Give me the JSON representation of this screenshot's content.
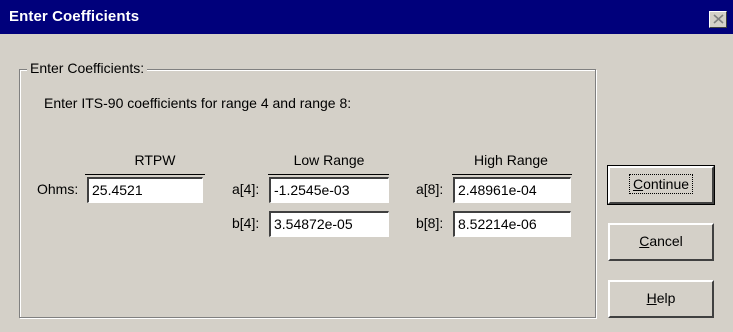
{
  "window": {
    "title": "Enter Coefficients"
  },
  "group": {
    "label": "Enter Coefficients:",
    "instructions": "Enter ITS-90 coefficients for range 4 and range 8:"
  },
  "columns": {
    "rtpw": {
      "header": "RTPW",
      "label": "Ohms:",
      "value": "25.4521"
    },
    "low": {
      "header": "Low Range",
      "a_label": "a[4]:",
      "a_value": "-1.2545e-03",
      "b_label": "b[4]:",
      "b_value": "3.54872e-05"
    },
    "high": {
      "header": "High Range",
      "a_label": "a[8]:",
      "a_value": "2.48961e-04",
      "b_label": "b[8]:",
      "b_value": "8.52214e-06"
    }
  },
  "buttons": {
    "continue": {
      "first": "C",
      "rest": "ontinue"
    },
    "cancel": {
      "first": "C",
      "rest": "ancel"
    },
    "help": {
      "first": "H",
      "rest": "elp"
    }
  }
}
